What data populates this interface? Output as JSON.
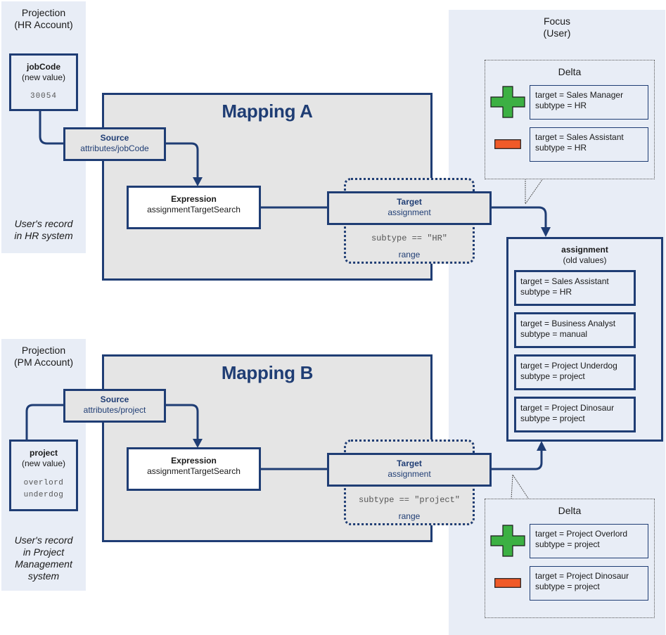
{
  "projection_hr": {
    "title_line1": "Projection",
    "title_line2": "(HR Account)",
    "attribute": {
      "name": "jobCode",
      "qualifier": "(new value)",
      "values": [
        "30054"
      ]
    },
    "note_lines": [
      "User's record",
      "in HR system"
    ]
  },
  "projection_pm": {
    "title_line1": "Projection",
    "title_line2": "(PM Account)",
    "attribute": {
      "name": "project",
      "qualifier": "(new value)",
      "values": [
        "overlord",
        "underdog"
      ]
    },
    "note_lines": [
      "User's record",
      "in Project",
      "Management",
      "system"
    ]
  },
  "mapping_a": {
    "title": "Mapping A",
    "source": {
      "label": "Source",
      "path": "attributes/jobCode"
    },
    "expression": {
      "label": "Expression",
      "value": "assignmentTargetSearch"
    },
    "target": {
      "label": "Target",
      "value": "assignment"
    },
    "range": {
      "condition": "subtype == \"HR\"",
      "label": "range"
    }
  },
  "mapping_b": {
    "title": "Mapping B",
    "source": {
      "label": "Source",
      "path": "attributes/project"
    },
    "expression": {
      "label": "Expression",
      "value": "assignmentTargetSearch"
    },
    "target": {
      "label": "Target",
      "value": "assignment"
    },
    "range": {
      "condition": "subtype == \"project\"",
      "label": "range"
    }
  },
  "focus": {
    "title_line1": "Focus",
    "title_line2": "(User)",
    "assignment": {
      "name": "assignment",
      "qualifier": "(old values)",
      "items": [
        {
          "target": "target = Sales Assistant",
          "subtype": "subtype = HR"
        },
        {
          "target": "target = Business Analyst",
          "subtype": "subtype = manual"
        },
        {
          "target": "target = Project Underdog",
          "subtype": "subtype = project"
        },
        {
          "target": "target = Project Dinosaur",
          "subtype": "subtype = project"
        }
      ]
    },
    "delta_a": {
      "title": "Delta",
      "add": {
        "icon": "plus-icon",
        "target": "target = Sales Manager",
        "subtype": "subtype = HR"
      },
      "remove": {
        "icon": "minus-icon",
        "target": "target = Sales Assistant",
        "subtype": "subtype = HR"
      }
    },
    "delta_b": {
      "title": "Delta",
      "add": {
        "icon": "plus-icon",
        "target": "target = Project Overlord",
        "subtype": "subtype = project"
      },
      "remove": {
        "icon": "minus-icon",
        "target": "target = Project Dinosaur",
        "subtype": "subtype = project"
      }
    }
  },
  "colors": {
    "navy": "#1f3d74",
    "panel_bg": "#e8edf6",
    "mapping_bg": "#e5e5e5",
    "plus_green": "#3cb043",
    "minus_orange": "#f05a28"
  }
}
